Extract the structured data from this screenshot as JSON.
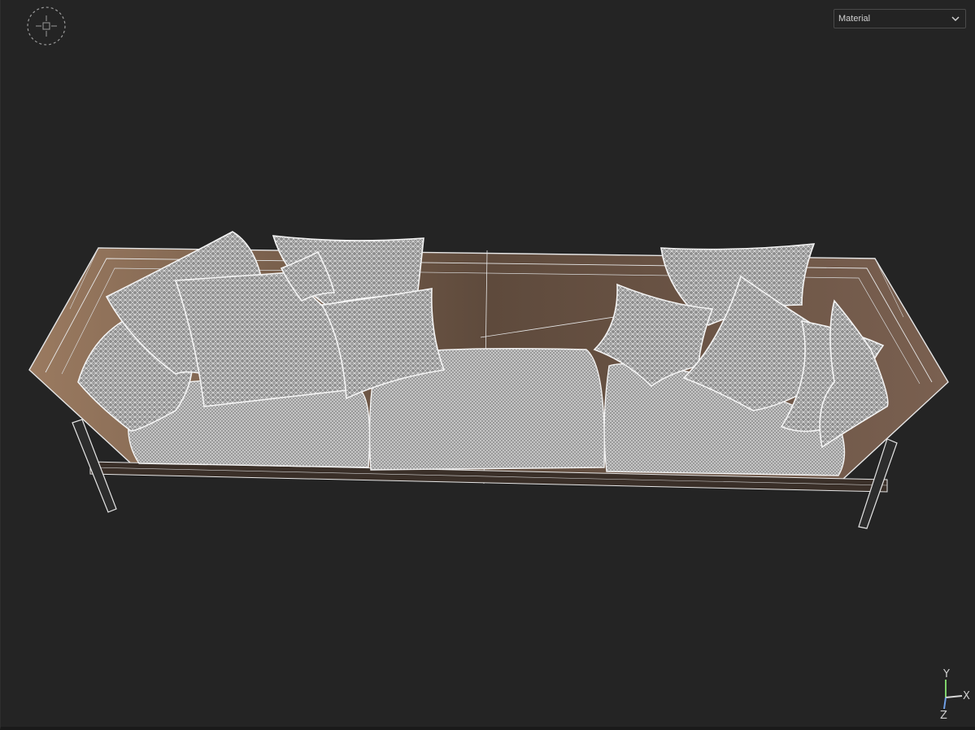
{
  "viewport": {
    "shading_mode": {
      "selected": "Material"
    },
    "axes": {
      "y": "Y",
      "x": "X",
      "z": "Z"
    },
    "icons": {
      "navigation": "navigation-gizmo-icon",
      "dropdown": "chevron-down-icon"
    },
    "colors": {
      "background": "#242424",
      "frame_fill": "#5e4a3c",
      "wire": "#e6e6e6",
      "axis_y": "#7fd36b",
      "axis_x": "#d8d8d8",
      "axis_z": "#6fa0e6"
    }
  }
}
